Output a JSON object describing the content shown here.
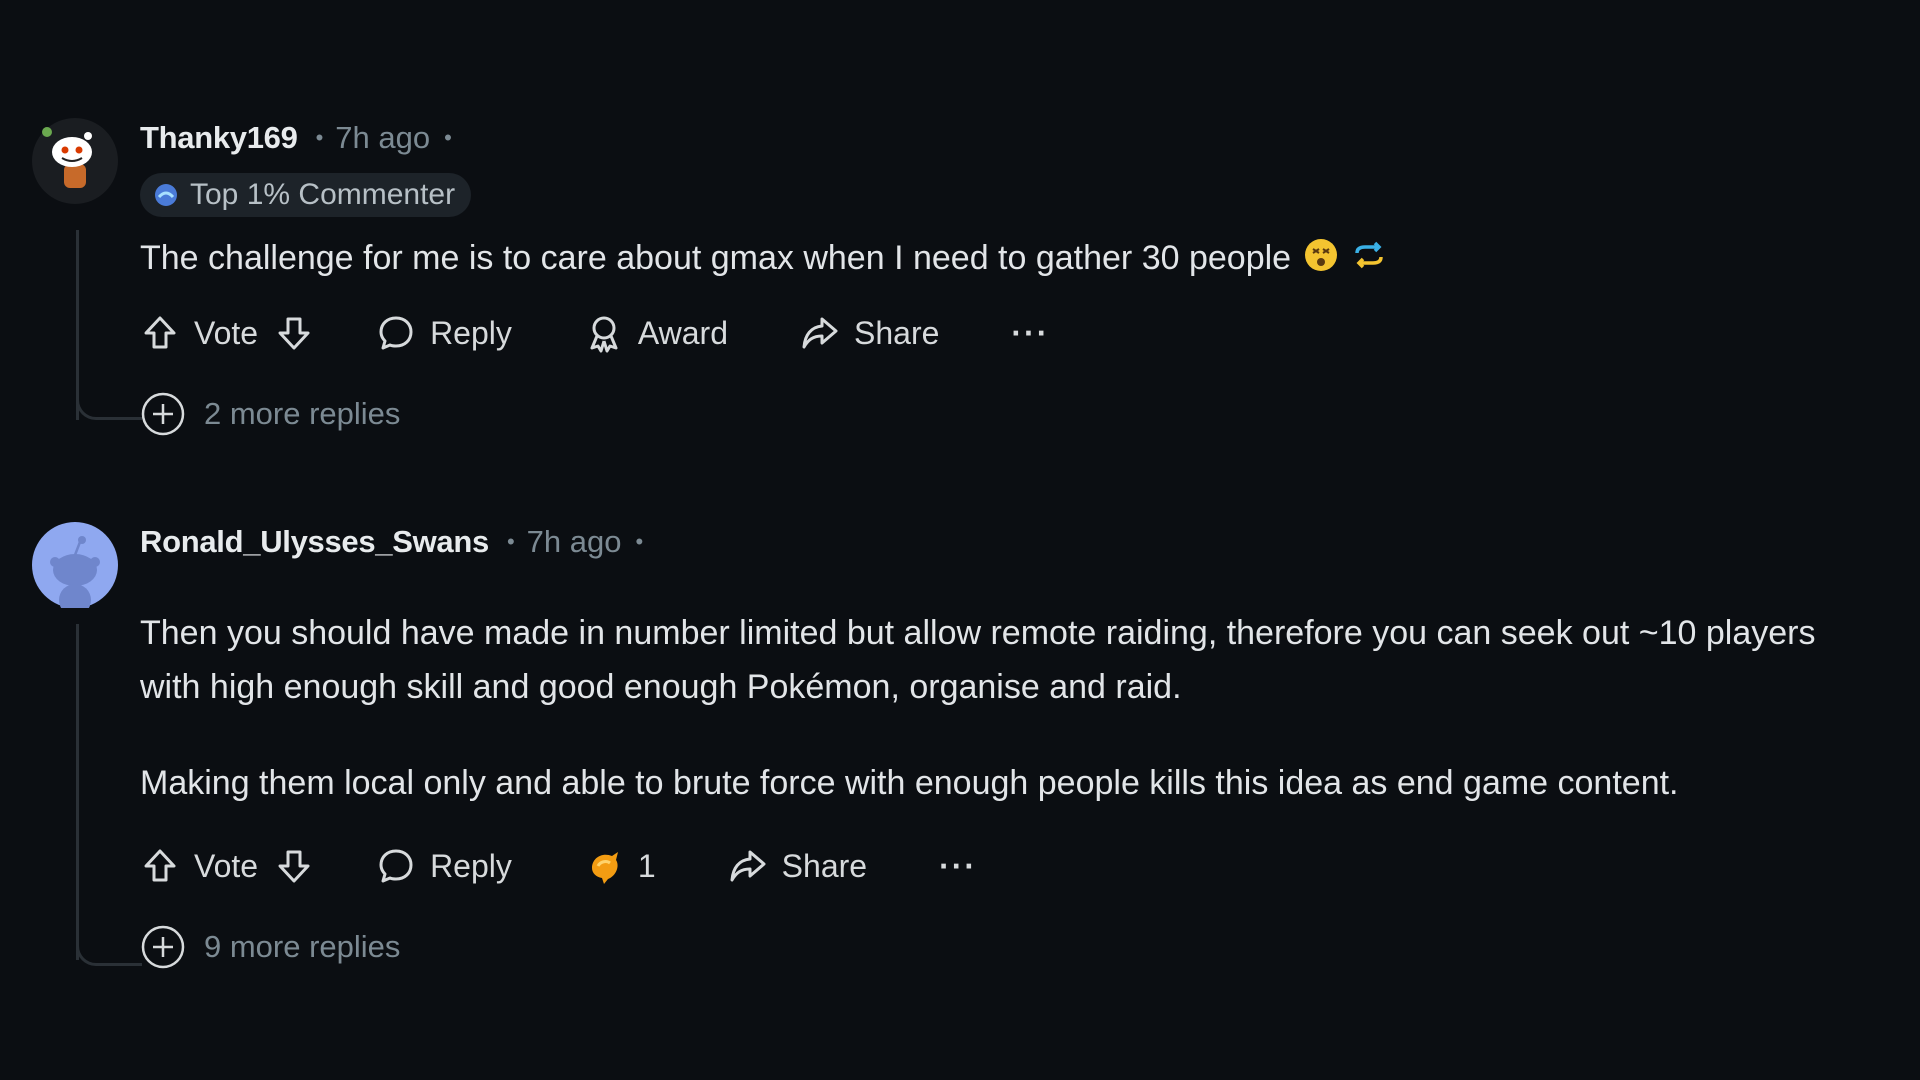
{
  "comments": [
    {
      "username": "Thanky169",
      "time": "7h ago",
      "flair": "Top 1% Commenter",
      "text": "The challenge for me is to care about gmax when I need to gather 30 people",
      "actions": {
        "vote": "Vote",
        "reply": "Reply",
        "award": "Award",
        "share": "Share",
        "more": "···"
      },
      "more_replies": "2 more replies"
    },
    {
      "username": "Ronald_Ulysses_Swans",
      "time": "7h ago",
      "paragraphs": [
        "Then you should have made in number limited but allow remote raiding, therefore you can seek out ~10 players with high enough skill and good enough Pokémon, organise and raid.",
        "Making them local only and able to brute force with enough people kills this idea as end game content."
      ],
      "actions": {
        "vote": "Vote",
        "reply": "Reply",
        "award_count": "1",
        "share": "Share",
        "more": "···"
      },
      "more_replies": "9 more replies"
    }
  ],
  "icons": [
    "upvote-icon",
    "downvote-icon",
    "reply-icon",
    "award-icon",
    "share-icon",
    "more-icon",
    "expand-icon"
  ],
  "colors": {
    "background": "#0b0e12",
    "text": "#d7dadc",
    "muted": "#7c8a93",
    "flair_bg": "#1d2329",
    "avatar_blue": "#8fa8f0"
  }
}
